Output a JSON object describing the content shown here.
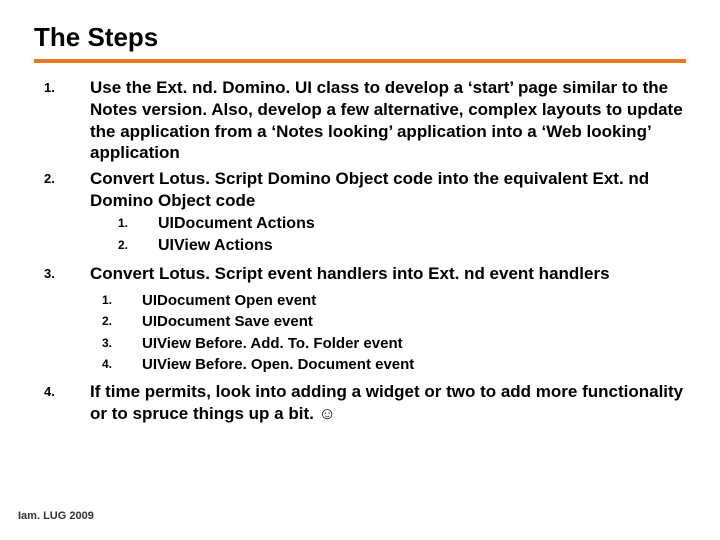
{
  "title": "The Steps",
  "items": [
    {
      "num": "1.",
      "text": "Use the Ext. nd. Domino. UI class to develop a ‘start’ page similar to the Notes version.  Also, develop a few alternative, complex layouts to update the application from a ‘Notes looking’ application into a ‘Web looking’ application"
    },
    {
      "num": "2.",
      "text": "Convert Lotus. Script Domino Object code into the equivalent Ext. nd Domino Object code",
      "sub": [
        {
          "num": "1.",
          "text": "UIDocument Actions"
        },
        {
          "num": "2.",
          "text": "UIView Actions"
        }
      ]
    },
    {
      "num": "3.",
      "text": "Convert Lotus. Script event handlers into Ext. nd event handlers",
      "subsub": [
        {
          "num": "1.",
          "text": "UIDocument Open event"
        },
        {
          "num": "2.",
          "text": "UIDocument Save event"
        },
        {
          "num": "3.",
          "text": "UIView Before. Add. To. Folder event"
        },
        {
          "num": "4.",
          "text": "UIView Before. Open. Document event"
        }
      ]
    },
    {
      "num": "4.",
      "text": "If time permits, look into adding a widget or two to add more functionality or to spruce things up a bit. ☺"
    }
  ],
  "footer": "Iam. LUG 2009"
}
